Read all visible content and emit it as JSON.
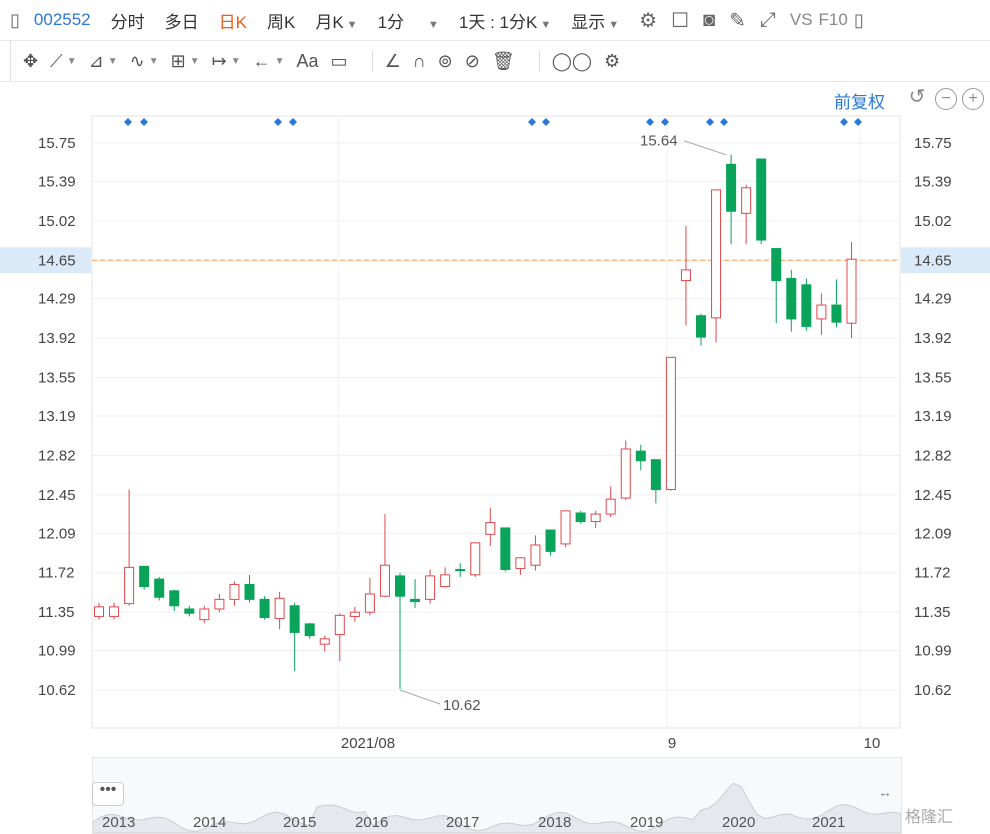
{
  "header": {
    "stock_code": "002552",
    "tabs": [
      "分时",
      "多日",
      "日K",
      "周K",
      "月K"
    ],
    "active_tab": "日K",
    "interval": "1分",
    "range": "1天 : 1分K",
    "display": "显示",
    "vs": "VS",
    "f10": "F10"
  },
  "controls": {
    "adjust": "前复权"
  },
  "chart_data": {
    "type": "candlestick",
    "y_ticks": [
      "15.75",
      "15.39",
      "15.02",
      "14.65",
      "14.29",
      "13.92",
      "13.55",
      "13.19",
      "12.82",
      "12.45",
      "12.09",
      "11.72",
      "11.35",
      "10.99",
      "10.62"
    ],
    "x_labels": [
      "2021/08",
      "9",
      "10"
    ],
    "ylim": [
      10.62,
      15.75
    ],
    "last_price": "14.65",
    "max_label": "15.64",
    "min_label": "10.62",
    "colors": {
      "up": "#e0484b",
      "down": "#0aa35a",
      "ref_line": "#f0a050"
    },
    "candles": [
      [
        11.31,
        11.4,
        11.28,
        11.44
      ],
      [
        11.31,
        11.4,
        11.28,
        11.44
      ],
      [
        11.43,
        11.77,
        11.41,
        12.5
      ],
      [
        11.78,
        11.59,
        11.56,
        11.78
      ],
      [
        11.66,
        11.49,
        11.46,
        11.68
      ],
      [
        11.55,
        11.41,
        11.36,
        11.56
      ],
      [
        11.38,
        11.34,
        11.31,
        11.41
      ],
      [
        11.28,
        11.38,
        11.25,
        11.41
      ],
      [
        11.38,
        11.47,
        11.35,
        11.52
      ],
      [
        11.47,
        11.61,
        11.41,
        11.64
      ],
      [
        11.61,
        11.47,
        11.44,
        11.7
      ],
      [
        11.47,
        11.3,
        11.28,
        11.5
      ],
      [
        11.29,
        11.48,
        11.19,
        11.54
      ],
      [
        11.41,
        11.16,
        10.8,
        11.44
      ],
      [
        11.24,
        11.13,
        11.1,
        11.25
      ],
      [
        11.05,
        11.1,
        10.98,
        11.13
      ],
      [
        11.14,
        11.32,
        10.89,
        11.34
      ],
      [
        11.31,
        11.35,
        11.26,
        11.4
      ],
      [
        11.35,
        11.52,
        11.32,
        11.67
      ],
      [
        11.5,
        11.79,
        11.49,
        12.27
      ],
      [
        11.69,
        11.5,
        10.63,
        11.72
      ],
      [
        11.47,
        11.45,
        11.39,
        11.66
      ],
      [
        11.47,
        11.69,
        11.43,
        11.75
      ],
      [
        11.59,
        11.7,
        11.58,
        11.77
      ],
      [
        11.75,
        11.74,
        11.68,
        11.81
      ],
      [
        11.7,
        12.0,
        11.68,
        12.0
      ],
      [
        12.08,
        12.19,
        11.97,
        12.33
      ],
      [
        12.14,
        11.75,
        11.73,
        12.14
      ],
      [
        11.76,
        11.86,
        11.7,
        11.86
      ],
      [
        11.79,
        11.98,
        11.74,
        12.07
      ],
      [
        12.12,
        11.92,
        11.88,
        12.12
      ],
      [
        11.99,
        12.3,
        11.96,
        12.3
      ],
      [
        12.28,
        12.2,
        12.18,
        12.3
      ],
      [
        12.2,
        12.27,
        12.14,
        12.3
      ],
      [
        12.27,
        12.41,
        12.24,
        12.53
      ],
      [
        12.42,
        12.88,
        12.4,
        12.96
      ],
      [
        12.86,
        12.77,
        12.68,
        12.92
      ],
      [
        12.78,
        12.5,
        12.37,
        12.78
      ],
      [
        12.5,
        13.74,
        12.49,
        13.74
      ],
      [
        14.46,
        14.56,
        14.04,
        14.97
      ],
      [
        14.13,
        13.93,
        13.85,
        14.15
      ],
      [
        14.11,
        15.31,
        13.88,
        15.31
      ],
      [
        15.55,
        15.11,
        14.8,
        15.64
      ],
      [
        15.09,
        15.33,
        14.8,
        15.36
      ],
      [
        15.6,
        14.84,
        14.8,
        15.6
      ],
      [
        14.76,
        14.46,
        14.06,
        14.76
      ],
      [
        14.48,
        14.1,
        13.98,
        14.56
      ],
      [
        14.42,
        14.03,
        13.99,
        14.48
      ],
      [
        14.1,
        14.23,
        13.95,
        14.34
      ],
      [
        14.23,
        14.07,
        14.02,
        14.47
      ],
      [
        14.06,
        14.66,
        13.92,
        14.82
      ]
    ]
  },
  "navigator": {
    "years": [
      "2013",
      "2014",
      "2015",
      "2016",
      "2017",
      "2018",
      "2019",
      "2020",
      "2021"
    ],
    "logo": "格隆汇",
    "more": "•••",
    "drag": "↔"
  }
}
